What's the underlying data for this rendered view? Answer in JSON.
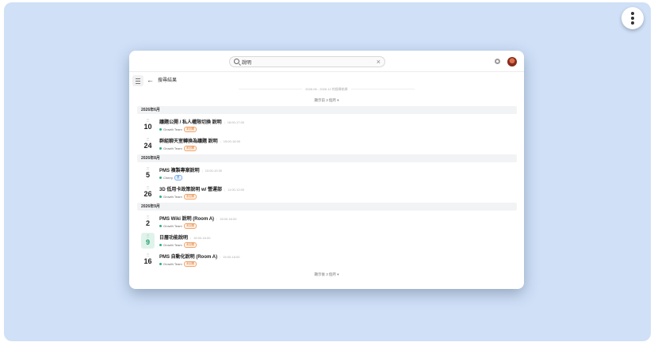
{
  "search": {
    "value": "說明",
    "clear_label": "×"
  },
  "header": {
    "back_label": "←",
    "title": "搜尋結果"
  },
  "range_label": "2026.06 - 2026.12 的搜尋結果",
  "expand_top": "顯示前 3 個月",
  "expand_bottom": "顯示後 3 個月",
  "months": [
    {
      "label": "2026年6月",
      "events": [
        {
          "dow": "三",
          "day": "10",
          "title": "議題公開 / 私人權限切換 說明",
          "time": "16:00-17:00",
          "team": "Growth Team",
          "badge": "未回覆",
          "badge_type": "orange",
          "today": false
        },
        {
          "dow": "三",
          "day": "24",
          "title": "群組聊天室轉換為議題 說明",
          "time": "15:00-16:00",
          "team": "Growth Team",
          "badge": "未回覆",
          "badge_type": "orange",
          "today": false
        }
      ]
    },
    {
      "label": "2026年8月",
      "events": [
        {
          "dow": "三",
          "day": "5",
          "title": "PMS 複製專案說明",
          "time": "10:00-10:30",
          "team": "Cherry",
          "badge": "是",
          "badge_type": "blue",
          "today": false
        },
        {
          "dow": "三",
          "day": "26",
          "title": "3D 低用卡政策說明 w/ 營運部",
          "time": "11:00-12:00",
          "team": "Growth Team",
          "badge": "未回覆",
          "badge_type": "orange",
          "today": false
        }
      ]
    },
    {
      "label": "2026年9月",
      "events": [
        {
          "dow": "三",
          "day": "2",
          "title": "PMS Wiki 說明 (Room A)",
          "time": "15:00-16:00",
          "team": "Growth Team",
          "badge": "未回覆",
          "badge_type": "orange",
          "today": false
        },
        {
          "dow": "三",
          "day": "9",
          "title": "日曆功能說明",
          "time": "15:00-16:00",
          "team": "Growth Team",
          "badge": "未回覆",
          "badge_type": "orange",
          "today": true
        },
        {
          "dow": "三",
          "day": "16",
          "title": "PMS 自動化說明 (Room A)",
          "time": "15:00-16:00",
          "team": "Growth Team",
          "badge": "未回覆",
          "badge_type": "orange",
          "today": false
        }
      ]
    }
  ],
  "colors": {
    "backdrop": "#cfe0f7",
    "accent_green": "#2fae7c",
    "badge_orange": "#e07b32",
    "badge_blue": "#3b7fd4"
  },
  "icons": [
    "kebab-menu-icon",
    "search-icon",
    "clear-icon",
    "gear-icon",
    "avatar",
    "sidebar-toggle-icon",
    "back-arrow-icon"
  ]
}
